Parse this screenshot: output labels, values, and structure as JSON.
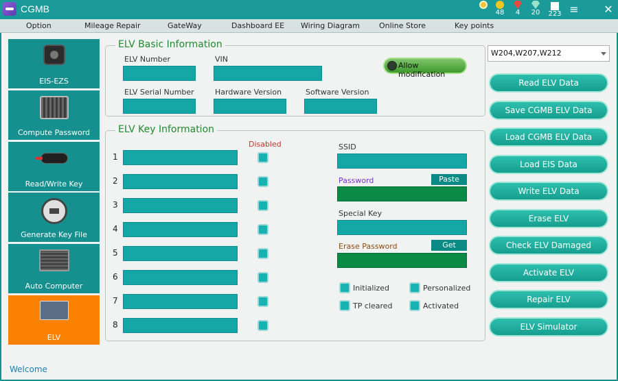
{
  "titlebar": {
    "app_name": "CGMB",
    "stats": {
      "medal": "",
      "coins": "48",
      "ruby": "4",
      "gems": "20",
      "chips": "223"
    },
    "menu_icon": "hamburger-icon",
    "close_icon": "close-icon"
  },
  "menu": [
    "Option",
    "Mileage Repair",
    "GateWay",
    "Dashboard EE",
    "Wiring Diagram",
    "Online Store",
    "Key points"
  ],
  "sidebar": [
    {
      "label": "EIS-EZS",
      "icon": "eis-ezs-icon",
      "active": false
    },
    {
      "label": "Compute Password",
      "icon": "keypad-icon",
      "active": false
    },
    {
      "label": "Read/Write Key",
      "icon": "key-fob-icon",
      "active": false
    },
    {
      "label": "Generate Key File",
      "icon": "disk-icon",
      "active": false
    },
    {
      "label": "Auto Computer",
      "icon": "ecu-icon",
      "active": false
    },
    {
      "label": "ELV",
      "icon": "elv-icon",
      "active": true
    }
  ],
  "basic": {
    "title": "ELV Basic Information",
    "elv_number_label": "ELV Number",
    "elv_number": "",
    "vin_label": "VIN",
    "vin": "",
    "serial_label": "ELV Serial Number",
    "serial": "",
    "hw_label": "Hardware Version",
    "hw": "",
    "sw_label": "Software Version",
    "sw": "",
    "allow_label": "Allow modification"
  },
  "keys": {
    "title": "ELV Key Information",
    "disabled_label": "Disabled",
    "rows": [
      {
        "num": "1",
        "value": ""
      },
      {
        "num": "2",
        "value": ""
      },
      {
        "num": "3",
        "value": ""
      },
      {
        "num": "4",
        "value": ""
      },
      {
        "num": "5",
        "value": ""
      },
      {
        "num": "6",
        "value": ""
      },
      {
        "num": "7",
        "value": ""
      },
      {
        "num": "8",
        "value": ""
      }
    ],
    "ssid_label": "SSID",
    "ssid": "",
    "password_label": "Password",
    "paste_label": "Paste",
    "password": "",
    "special_label": "Special Key",
    "special": "",
    "erase_label": "Erase Password",
    "get_label": "Get",
    "erase": "",
    "flags": [
      "Initialized",
      "Personalized",
      "TP cleared",
      "Activated"
    ]
  },
  "right": {
    "model_select": "W204,W207,W212",
    "buttons": [
      "Read ELV Data",
      "Save CGMB ELV Data",
      "Load CGMB ELV Data",
      "Load EIS Data",
      "Write ELV Data",
      "Erase ELV",
      "Check ELV Damaged",
      "Activate ELV",
      "Repair ELV",
      "ELV Simulator"
    ]
  },
  "status": "Welcome",
  "colors": {
    "accent": "#1b9a9a",
    "field": "#15a6a6",
    "active_tab": "#fa8200",
    "title_green": "#1f8a2e"
  }
}
